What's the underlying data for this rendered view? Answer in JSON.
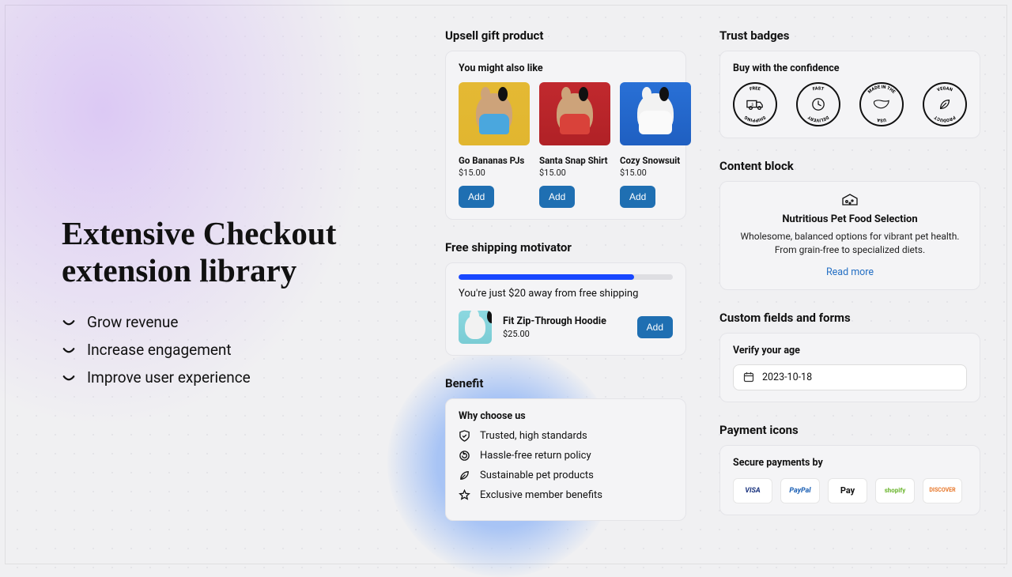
{
  "headline": "Extensive Checkout extension library",
  "bullets": [
    "Grow revenue",
    "Increase engagement",
    "Improve user experience"
  ],
  "upsell": {
    "title": "Upsell gift product",
    "subtitle": "You might also like",
    "products": [
      {
        "name": "Go Bananas PJs",
        "price": "$15.00",
        "add": "Add"
      },
      {
        "name": "Santa Snap Shirt",
        "price": "$15.00",
        "add": "Add"
      },
      {
        "name": "Cozy Snowsuit",
        "price": "$15.00",
        "add": "Add"
      }
    ]
  },
  "shipping": {
    "title": "Free shipping motivator",
    "message": "You're just $20 away from free shipping",
    "progress_pct": 82,
    "item": {
      "name": "Fit Zip-Through Hoodie",
      "price": "$25.00",
      "add": "Add"
    }
  },
  "benefit": {
    "title": "Benefit",
    "subtitle": "Why choose us",
    "items": [
      "Trusted, high standards",
      "Hassle-free return policy",
      "Sustainable pet products",
      "Exclusive member benefits"
    ]
  },
  "trust": {
    "title": "Trust badges",
    "subtitle": "Buy with the confidence",
    "badges": [
      {
        "top": "FREE",
        "bottom": "SHIPPING"
      },
      {
        "top": "FAST",
        "bottom": "DELIVERY"
      },
      {
        "top": "MADE IN THE",
        "bottom": "USA"
      },
      {
        "top": "VEGAN",
        "bottom": "PRODUCT"
      }
    ]
  },
  "content": {
    "title": "Content block",
    "heading": "Nutritious Pet Food Selection",
    "desc": "Wholesome, balanced options for vibrant pet health. From grain-free to specialized diets.",
    "link": "Read more"
  },
  "custom": {
    "title": "Custom fields and forms",
    "label": "Verify your age",
    "value": "2023-10-18"
  },
  "payment": {
    "title": "Payment icons",
    "subtitle": "Secure payments by",
    "providers": [
      "VISA",
      "PayPal",
      "⌘Pay",
      "shopify",
      "DISCOVER"
    ]
  }
}
